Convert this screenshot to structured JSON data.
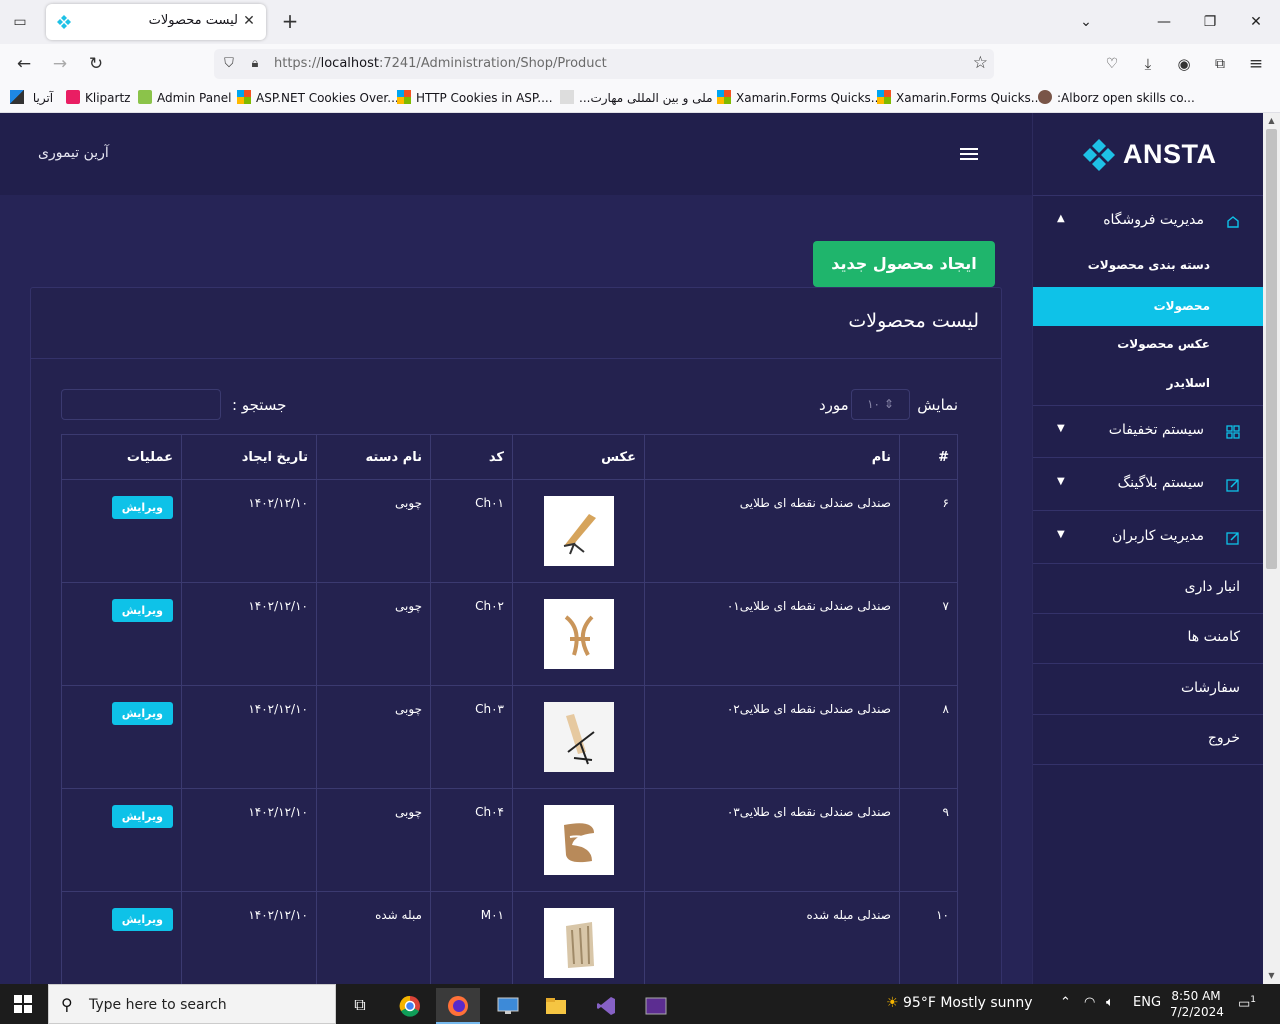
{
  "browser": {
    "tab_title": "لیست محصولات",
    "url_prefix": "https://",
    "url_host": "localhost",
    "url_rest": ":7241/Administration/Shop/Product",
    "bookmarks": [
      {
        "label": "آتریا",
        "icon": "atria-icon"
      },
      {
        "label": "Klipartz",
        "icon": "klipartz-icon"
      },
      {
        "label": "Admin Panel",
        "icon": "admin-panel-icon"
      },
      {
        "label": "ASP.NET Cookies Over...",
        "icon": "microsoft-icon"
      },
      {
        "label": "HTTP Cookies in ASP....",
        "icon": "microsoft-icon"
      },
      {
        "label": "...ملی و بین المللی مهارت",
        "icon": "doc-icon"
      },
      {
        "label": "Xamarin.Forms Quicks...",
        "icon": "microsoft-icon"
      },
      {
        "label": "Xamarin.Forms Quicks...",
        "icon": "microsoft-icon"
      },
      {
        "label": ":Alborz open skills co...",
        "icon": "alborz-icon"
      }
    ]
  },
  "header": {
    "user_name": "آرین تیموری"
  },
  "sidebar": {
    "logo": "ANSTA",
    "groups": [
      {
        "label": "مدیریت فروشگاه",
        "expanded": true,
        "icon": "home-icon"
      },
      {
        "label": "سیستم تخفیفات",
        "expanded": false,
        "icon": "grid-icon"
      },
      {
        "label": "سیستم بلاگینگ",
        "expanded": false,
        "icon": "edit-icon"
      },
      {
        "label": "مدیریت کاربران",
        "expanded": false,
        "icon": "edit-icon"
      }
    ],
    "shop_items": [
      "دسته بندی محصولات",
      "محصولات",
      "عکس محصولات",
      "اسلایدر"
    ],
    "active_item": "محصولات",
    "items": [
      "انبار داری",
      "کامنت ها",
      "سفارشات",
      "خروج"
    ]
  },
  "main": {
    "create_button": "ایجاد محصول جدید",
    "card_title": "لیست محصولات",
    "show_label": "نمایش",
    "page_size": "۱۰",
    "show_unit": "مورد",
    "search_label": "جستجو :",
    "search_value": "",
    "columns": [
      "#",
      "نام",
      "عکس",
      "کد",
      "نام دسته",
      "تاریخ ایجاد",
      "عملیات"
    ],
    "rows": [
      {
        "id": "۶",
        "name": "صندلی صندلی نقطه ای طلایی",
        "code": "Ch۰۱",
        "category": "چوبی",
        "date": "۱۴۰۲/۱۲/۱۰",
        "action": "ویرایش"
      },
      {
        "id": "۷",
        "name": "صندلی صندلی نقطه ای طلایی۰۱",
        "code": "Ch۰۲",
        "category": "چوبی",
        "date": "۱۴۰۲/۱۲/۱۰",
        "action": "ویرایش"
      },
      {
        "id": "۸",
        "name": "صندلی صندلی نقطه ای طلایی۰۲",
        "code": "Ch۰۳",
        "category": "چوبی",
        "date": "۱۴۰۲/۱۲/۱۰",
        "action": "ویرایش"
      },
      {
        "id": "۹",
        "name": "صندلی صندلی نقطه ای طلایی۰۳",
        "code": "Ch۰۴",
        "category": "چوبی",
        "date": "۱۴۰۲/۱۲/۱۰",
        "action": "ویرایش"
      },
      {
        "id": "۱۰",
        "name": "صندلی مبله شده",
        "code": "M۰۱",
        "category": "مبله شده",
        "date": "۱۴۰۲/۱۲/۱۰",
        "action": "ویرایش"
      }
    ]
  },
  "taskbar": {
    "search_placeholder": "Type here to search",
    "weather": "95°F  Mostly sunny",
    "language": "ENG",
    "time": "8:50 AM",
    "date": "7/2/2024",
    "notification_count": "1"
  },
  "colors": {
    "app_bg": "#262456",
    "sidebar_bg": "#211f4c",
    "accent": "#0ec2e8",
    "create_button": "#1fb56c"
  }
}
